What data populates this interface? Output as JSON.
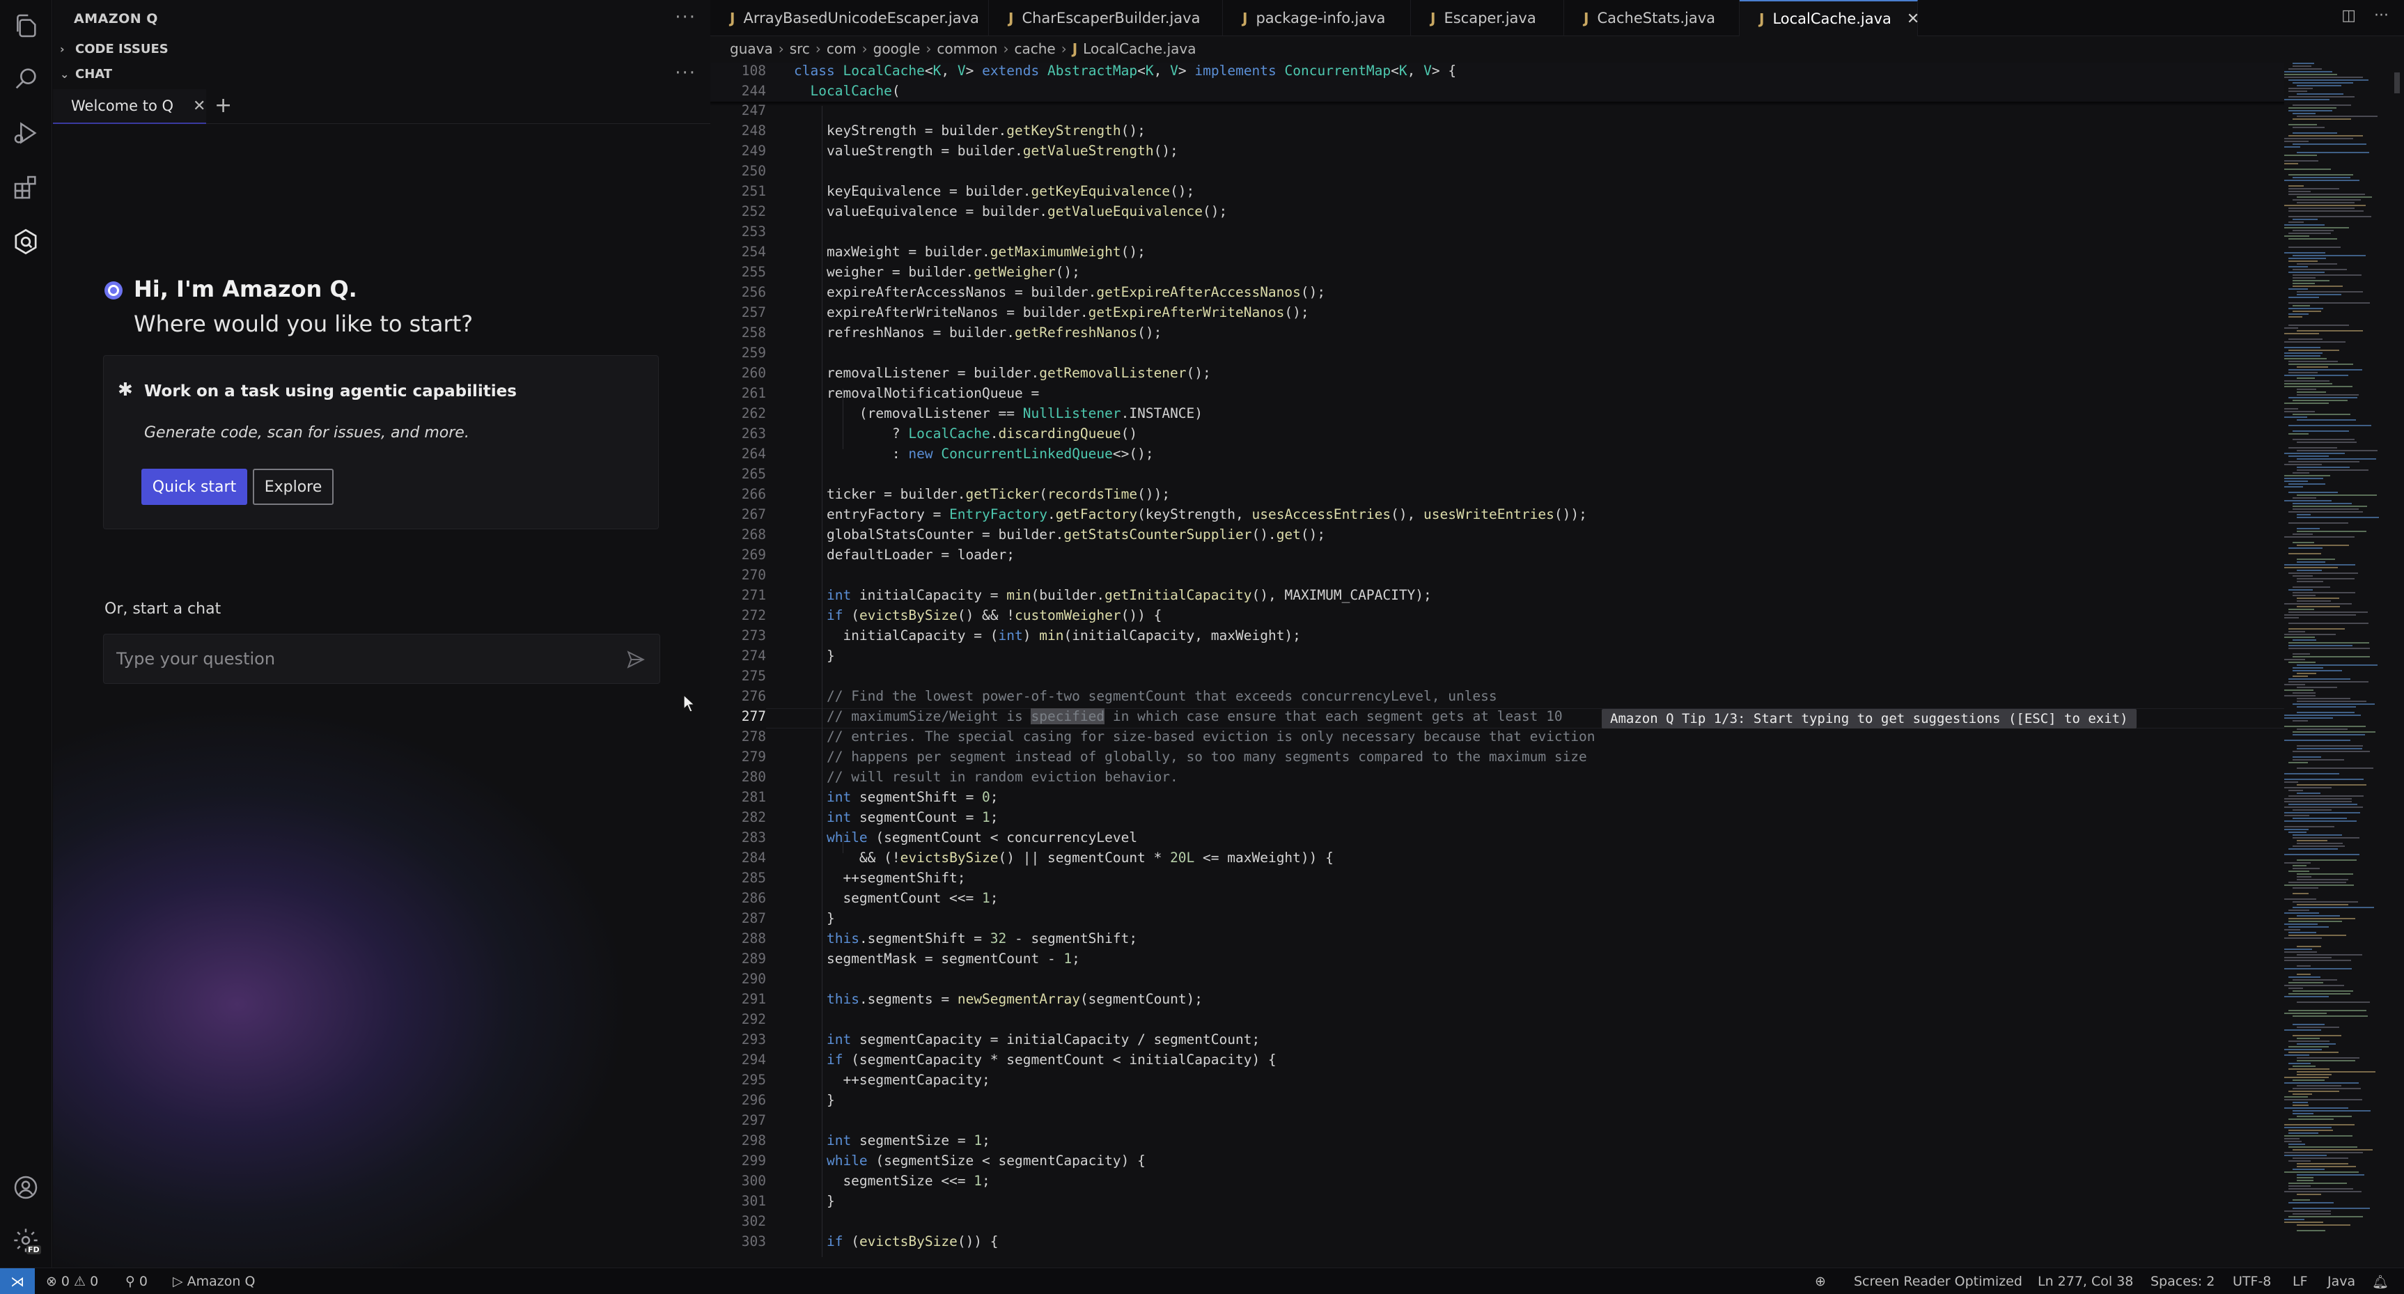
{
  "activity_bar": {
    "icons": [
      "files-icon",
      "search-icon",
      "run-debug-icon",
      "extensions-icon",
      "amazon-q-icon",
      "account-icon",
      "settings-gear-icon"
    ],
    "settings_badge": "FD"
  },
  "side_panel": {
    "title": "AMAZON Q",
    "sections": {
      "code_issues": "CODE ISSUES",
      "chat": "CHAT"
    },
    "chat_tab": "Welcome to Q",
    "greeting": "Hi, I'm Amazon Q.",
    "greeting_sub": "Where would you like to start?",
    "task_card": {
      "title": "Work on a task using agentic capabilities",
      "description": "Generate code, scan for issues, and more.",
      "quick_start": "Quick start",
      "explore": "Explore"
    },
    "start_chat_label": "Or, start a chat",
    "input_placeholder": "Type your question"
  },
  "editor": {
    "tabs": [
      {
        "label": "ArrayBasedUnicodeEscaper.java",
        "active": false
      },
      {
        "label": "CharEscaperBuilder.java",
        "active": false
      },
      {
        "label": "package-info.java",
        "active": false
      },
      {
        "label": "Escaper.java",
        "active": false
      },
      {
        "label": "CacheStats.java",
        "active": false
      },
      {
        "label": "LocalCache.java",
        "active": true
      }
    ],
    "file_icon": "J",
    "breadcrumb": [
      "guava",
      "src",
      "com",
      "google",
      "common",
      "cache",
      "LocalCache.java"
    ],
    "sticky_lines": [
      {
        "n": "108",
        "src": "class LocalCache<K, V> extends AbstractMap<K, V> implements ConcurrentMap<K, V> {"
      },
      {
        "n": "244",
        "src": "  LocalCache("
      }
    ],
    "first_line": 247,
    "current_line": 277,
    "lines": [
      "",
      "    keyStrength = builder.getKeyStrength();",
      "    valueStrength = builder.getValueStrength();",
      "",
      "    keyEquivalence = builder.getKeyEquivalence();",
      "    valueEquivalence = builder.getValueEquivalence();",
      "",
      "    maxWeight = builder.getMaximumWeight();",
      "    weigher = builder.getWeigher();",
      "    expireAfterAccessNanos = builder.getExpireAfterAccessNanos();",
      "    expireAfterWriteNanos = builder.getExpireAfterWriteNanos();",
      "    refreshNanos = builder.getRefreshNanos();",
      "",
      "    removalListener = builder.getRemovalListener();",
      "    removalNotificationQueue =",
      "        (removalListener == NullListener.INSTANCE)",
      "            ? LocalCache.discardingQueue()",
      "            : new ConcurrentLinkedQueue<>();",
      "",
      "    ticker = builder.getTicker(recordsTime());",
      "    entryFactory = EntryFactory.getFactory(keyStrength, usesAccessEntries(), usesWriteEntries());",
      "    globalStatsCounter = builder.getStatsCounterSupplier().get();",
      "    defaultLoader = loader;",
      "",
      "    int initialCapacity = min(builder.getInitialCapacity(), MAXIMUM_CAPACITY);",
      "    if (evictsBySize() && !customWeigher()) {",
      "      initialCapacity = (int) min(initialCapacity, maxWeight);",
      "    }",
      "",
      "    // Find the lowest power-of-two segmentCount that exceeds concurrencyLevel, unless",
      "    // maximumSize/Weight is specified in which case ensure that each segment gets at least 10",
      "    // entries. The special casing for size-based eviction is only necessary because that eviction",
      "    // happens per segment instead of globally, so too many segments compared to the maximum size",
      "    // will result in random eviction behavior.",
      "    int segmentShift = 0;",
      "    int segmentCount = 1;",
      "    while (segmentCount < concurrencyLevel",
      "        && (!evictsBySize() || segmentCount * 20L <= maxWeight)) {",
      "      ++segmentShift;",
      "      segmentCount <<= 1;",
      "    }",
      "    this.segmentShift = 32 - segmentShift;",
      "    segmentMask = segmentCount - 1;",
      "",
      "    this.segments = newSegmentArray(segmentCount);",
      "",
      "    int segmentCapacity = initialCapacity / segmentCount;",
      "    if (segmentCapacity * segmentCount < initialCapacity) {",
      "      ++segmentCapacity;",
      "    }",
      "",
      "    int segmentSize = 1;",
      "    while (segmentSize < segmentCapacity) {",
      "      segmentSize <<= 1;",
      "    }",
      "",
      "    if (evictsBySize()) {"
    ],
    "tip": "Amazon Q Tip 1/3: Start typing to get suggestions ([ESC] to exit)"
  },
  "status_bar": {
    "errors": "0",
    "warnings": "0",
    "ports": "0",
    "amazon_q": "Amazon Q",
    "screen_reader": "Screen Reader Optimized",
    "position": "Ln 277, Col 38",
    "spaces": "Spaces: 2",
    "encoding": "UTF-8",
    "eol": "LF",
    "language": "Java"
  },
  "colors": {
    "accent_button": "#4a4fd8",
    "remote_indicator": "#2d6fc0",
    "keyword": "#5b8fd6",
    "type": "#4ec9b0",
    "function": "#dcdcaa",
    "comment": "#7a7f86"
  }
}
